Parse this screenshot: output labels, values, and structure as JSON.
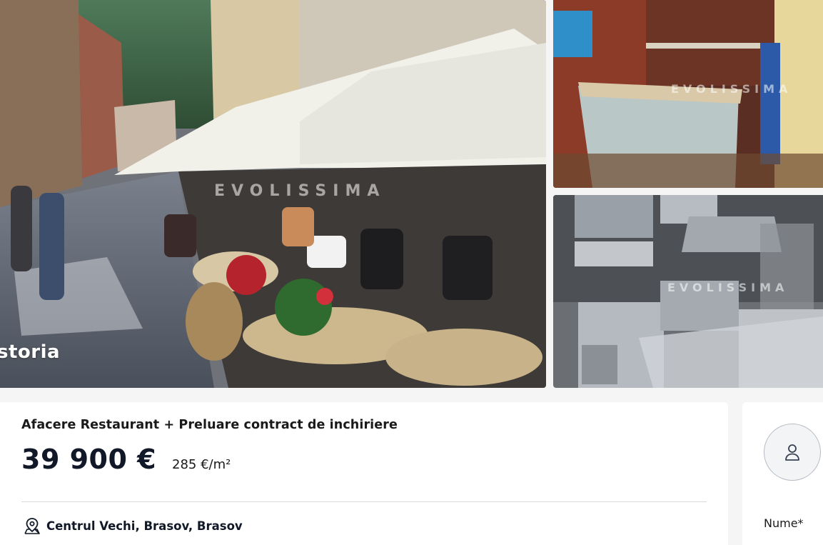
{
  "gallery": {
    "main_photo_alt": "",
    "source_logo": "storia",
    "watermark_text": "EVOLISSIMA"
  },
  "listing": {
    "title": "Afacere Restaurant + Preluare contract de inchiriere",
    "price": "39 900 €",
    "price_per_sqm": "285 €/m²",
    "location": "Centrul Vechi, Brasov, Brasov",
    "location_icon": "map-pin-icon"
  },
  "contact": {
    "avatar_icon": "user-icon",
    "name_label": "Nume*"
  },
  "colors": {
    "background": "#f5f5f5",
    "card": "#ffffff",
    "text_primary": "#111827",
    "divider": "#d9d9d9"
  }
}
